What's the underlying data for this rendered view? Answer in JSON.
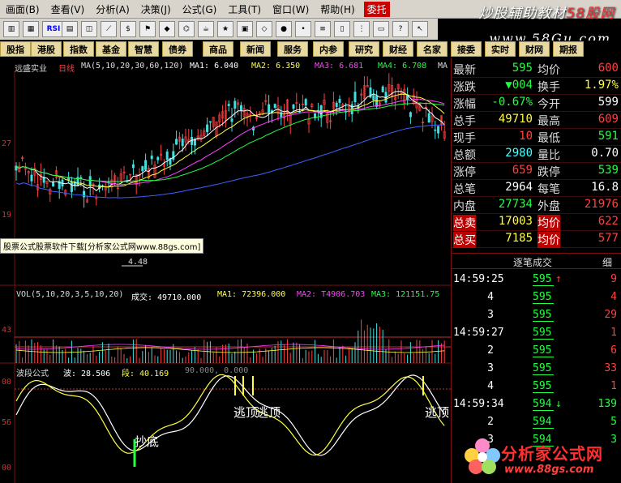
{
  "menubar": {
    "items": [
      "画面(B)",
      "查看(V)",
      "分析(A)",
      "决策(J)",
      "公式(G)",
      "工具(T)",
      "窗口(W)",
      "帮助(H)"
    ],
    "entrust": "委托"
  },
  "brand": {
    "text_a": "炒股辅助教材",
    "text_b": "58股网",
    "url": "www.58Gu.com"
  },
  "toolbar": {
    "icons": [
      "chart-icon",
      "grid-icon",
      "rsi-icon",
      "bar-icon",
      "layout-icon",
      "ruler-icon",
      "dollar-icon",
      "flag-icon",
      "chip-icon",
      "binoculars-icon",
      "cup-icon",
      "star-icon",
      "news-icon",
      "diamond-icon",
      "circle-icon",
      "dot-icon",
      "stack-icon",
      "book-icon",
      "signal-icon",
      "window-icon",
      "help-icon",
      "cursor-icon"
    ]
  },
  "quickbar": [
    "股指",
    "港股",
    "指数",
    "基金",
    "智慧",
    "债券",
    "商品",
    "新闻",
    "服务",
    "内参",
    "研究",
    "财经",
    "名家",
    "接委",
    "实时",
    "财网",
    "期报"
  ],
  "chart": {
    "stock_name": "远盛实业",
    "period": "日线",
    "ma_params": "MA(5,10,20,30,60,120)",
    "ma1": "MA1: 6.040",
    "ma2": "MA2: 6.350",
    "ma3": "MA3: 6.681",
    "ma4": "MA4: 6.708",
    "ma_more": "MA",
    "low_marker": "4.48",
    "axis_ticks": [
      ".27",
      ".19",
      ".43",
      ".56",
      ".00"
    ],
    "axis_top_tick": "27",
    "axis_mid_tick": "19",
    "vol": {
      "params": "VOL(5,10,20,3,5,10,20)",
      "chengjiao": "成交: 49710.000",
      "ma1": "MA1: 72396.000",
      "ma2": "MA2: T4906.703",
      "ma3": "MA3: 121151.75",
      "tick": "43"
    },
    "wave": {
      "name": "波段公式",
      "bo": "波: 28.506",
      "duan": "段: 40.169",
      "ninety": "90.000, 0.000",
      "label_buy": "抄底",
      "label_escape1": "逃顶",
      "label_escape2": "逃顶",
      "label_escape3": "逃顶",
      "ticks": [
        "00",
        "56",
        "00"
      ]
    },
    "ad_banner": "股票公式股票软件下载[分析家公式网www.88gs.com]"
  },
  "quote": {
    "rows": [
      {
        "k": "最新",
        "v": "595",
        "vc": "green",
        "k2": "均价",
        "v2": "600",
        "v2c": "red"
      },
      {
        "k": "涨跌",
        "v": "▼004",
        "vc": "green",
        "k2": "换手",
        "v2": "1.97%",
        "v2c": "yellow"
      },
      {
        "k": "涨幅",
        "v": "-0.67%",
        "vc": "green",
        "k2": "今开",
        "v2": "599",
        "v2c": "white"
      },
      {
        "k": "总手",
        "v": "49710",
        "vc": "yellow",
        "k2": "最高",
        "v2": "609",
        "v2c": "red"
      },
      {
        "k": "现手",
        "v": "10",
        "vc": "red",
        "k2": "最低",
        "v2": "591",
        "v2c": "green"
      },
      {
        "k": "总额",
        "v": "2980",
        "vc": "cyan",
        "k2": "量比",
        "v2": "0.70",
        "v2c": "white"
      },
      {
        "k": "涨停",
        "v": "659",
        "vc": "red",
        "k2": "跌停",
        "v2": "539",
        "v2c": "green"
      },
      {
        "k": "总笔",
        "v": "2964",
        "vc": "white",
        "k2": "每笔",
        "v2": "16.8",
        "v2c": "white"
      },
      {
        "k": "内盘",
        "v": "27734",
        "vc": "green",
        "k2": "外盘",
        "v2": "21976",
        "v2c": "red"
      },
      {
        "k": "总卖",
        "v": "17003",
        "vc": "yellow",
        "k2": "均价",
        "v2": "622",
        "v2c": "red",
        "hl": true
      },
      {
        "k": "总买",
        "v": "7185",
        "vc": "yellow",
        "k2": "均价",
        "v2": "577",
        "v2c": "red",
        "hl": true
      }
    ],
    "trade_title": "逐笔成交",
    "trade_detail": "细",
    "trades": [
      {
        "t": "14:59:25",
        "p": "595",
        "pc": "green",
        "arrow": "↑",
        "ac": "red",
        "n": "9",
        "nc": "red"
      },
      {
        "t": "4",
        "p": "595",
        "pc": "green",
        "arrow": "",
        "ac": "",
        "n": "4",
        "nc": "red"
      },
      {
        "t": "3",
        "p": "595",
        "pc": "green",
        "arrow": "",
        "ac": "",
        "n": "29",
        "nc": "red"
      },
      {
        "t": "14:59:27",
        "p": "595",
        "pc": "green",
        "arrow": "",
        "ac": "",
        "n": "1",
        "nc": "red"
      },
      {
        "t": "2",
        "p": "595",
        "pc": "green",
        "arrow": "",
        "ac": "",
        "n": "6",
        "nc": "red"
      },
      {
        "t": "3",
        "p": "595",
        "pc": "green",
        "arrow": "",
        "ac": "",
        "n": "33",
        "nc": "red"
      },
      {
        "t": "4",
        "p": "595",
        "pc": "green",
        "arrow": "",
        "ac": "",
        "n": "1",
        "nc": "red"
      },
      {
        "t": "14:59:34",
        "p": "594",
        "pc": "green",
        "arrow": "↓",
        "ac": "green",
        "n": "139",
        "nc": "green"
      },
      {
        "t": "2",
        "p": "594",
        "pc": "green",
        "arrow": "",
        "ac": "",
        "n": "5",
        "nc": "green"
      },
      {
        "t": "3",
        "p": "594",
        "pc": "green",
        "arrow": "",
        "ac": "",
        "n": "3",
        "nc": "green"
      }
    ]
  },
  "footer": {
    "logo_text": "分析家公式网",
    "logo_url": "www.88gs.com"
  },
  "colors": {
    "bg": "#000000",
    "up": "#ff4040",
    "down": "#20ff40",
    "menubar": "#d8d4cc"
  }
}
